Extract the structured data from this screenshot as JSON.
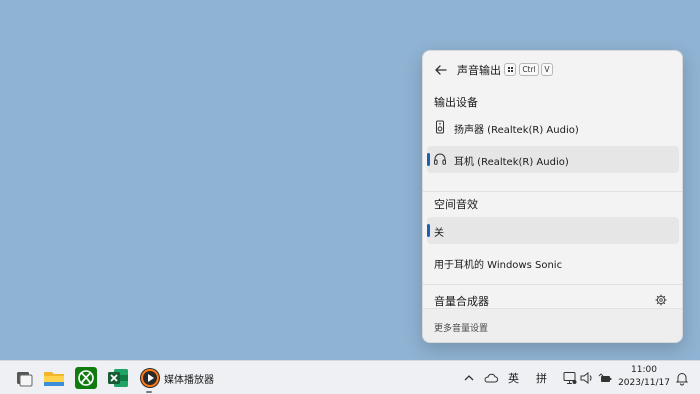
{
  "panel": {
    "title": "声音输出",
    "shortcut": {
      "win_icon": "windows-logo",
      "ctrl": "Ctrl",
      "v": "V"
    },
    "output_section_label": "输出设备",
    "devices": [
      {
        "name": "扬声器 (Realtek(R) Audio)",
        "icon": "speaker-icon",
        "selected": false
      },
      {
        "name": "耳机 (Realtek(R) Audio)",
        "icon": "headphones-icon",
        "selected": true
      }
    ],
    "spatial_section_label": "空间音效",
    "spatial_options": [
      {
        "name": "关",
        "selected": true
      },
      {
        "name": "用于耳机的 Windows Sonic",
        "selected": false
      }
    ],
    "mixer_label": "音量合成器",
    "mixer_icon": "gear-icon",
    "footer_link": "更多音量设置",
    "accent_color": "#1f5fb3"
  },
  "taskbar": {
    "pinned": [
      "task-view-icon",
      "file-explorer-icon",
      "xbox-icon",
      "excel-icon",
      "media-player-icon"
    ],
    "media_player_label": "媒体播放器",
    "tray": {
      "chevron": "chevron-up-icon",
      "onedrive": "cloud-icon",
      "ime_lang": "英",
      "ime_mode": "拼",
      "icons": [
        "network-icon",
        "volume-icon",
        "battery-icon"
      ]
    },
    "clock": {
      "time": "11:00",
      "date": "2023/11/17"
    },
    "notification_icon": "bell-icon"
  }
}
